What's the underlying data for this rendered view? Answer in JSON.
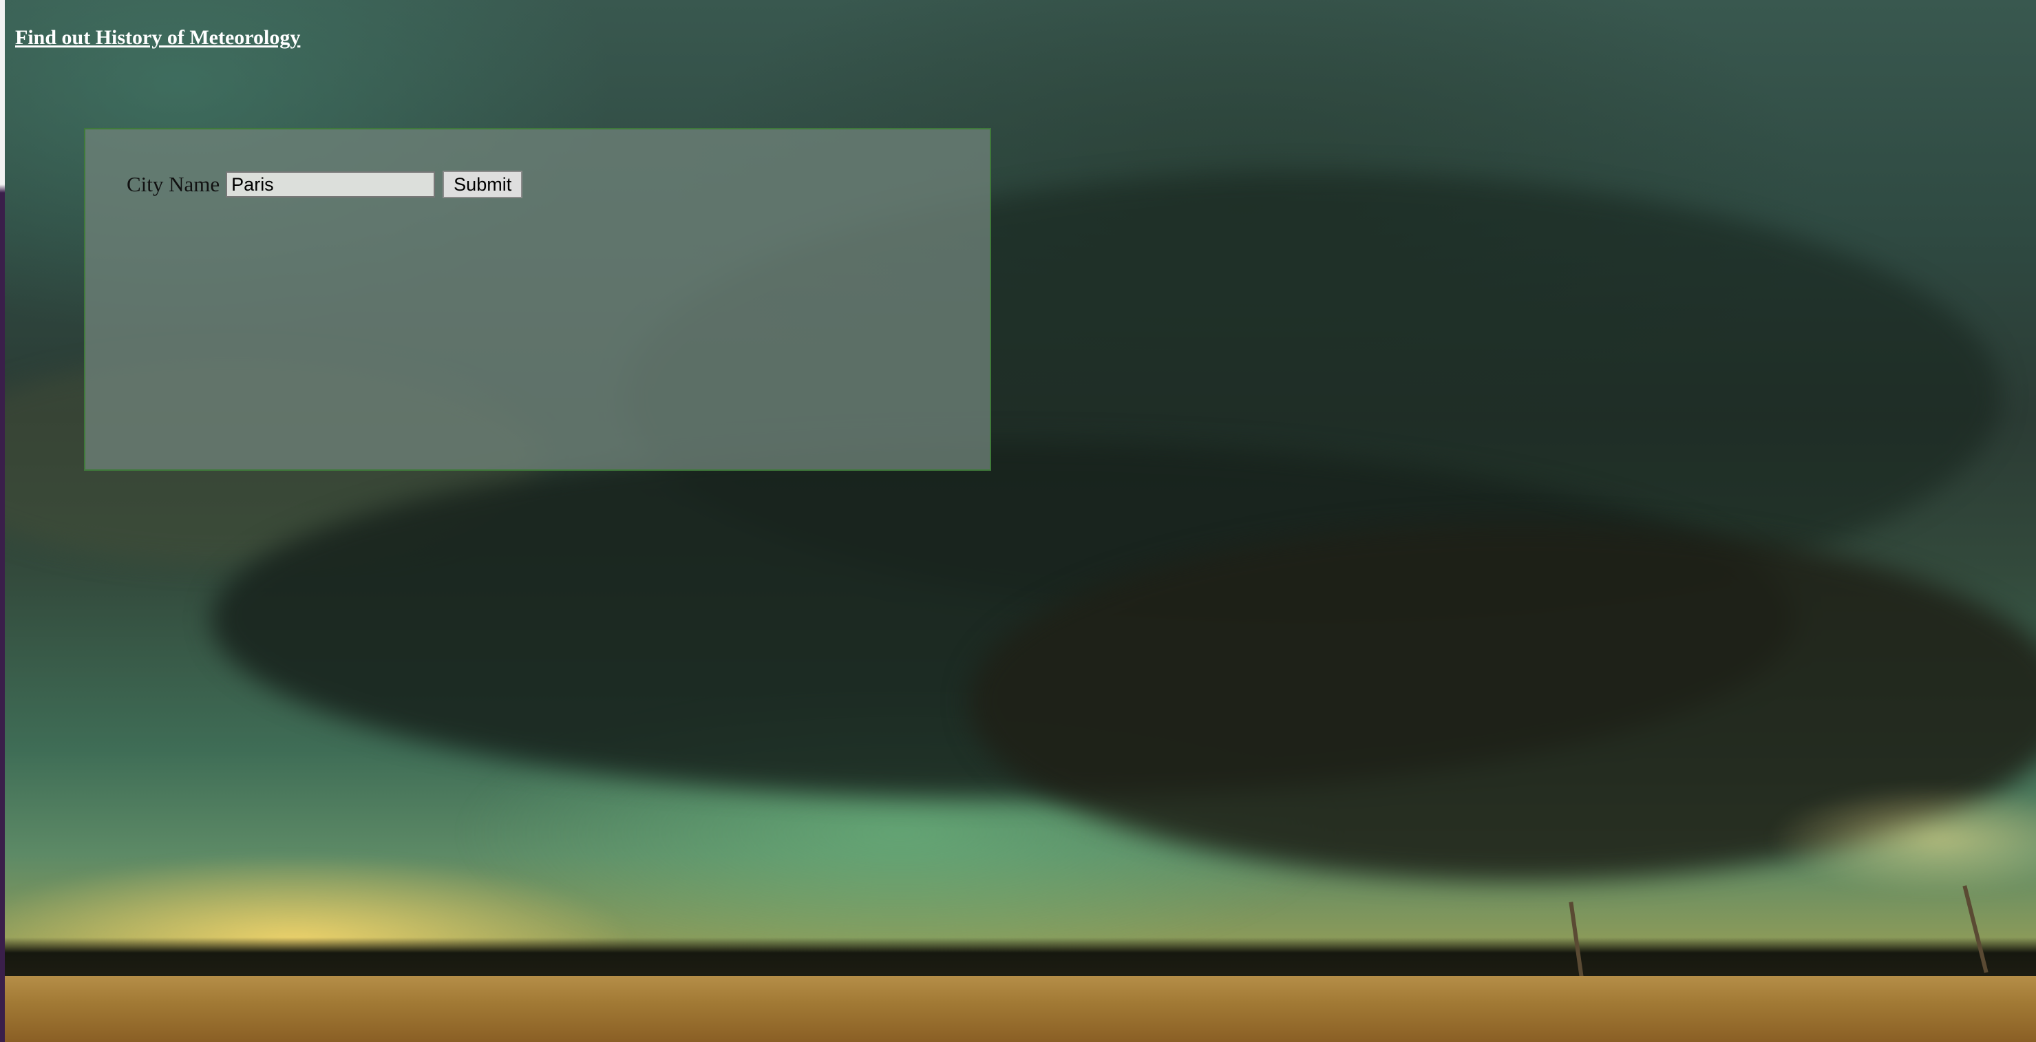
{
  "nav": {
    "history_link": "Find out History of Meteorology"
  },
  "form": {
    "city_label": "City Name",
    "city_value": "Paris",
    "submit_label": "Submit"
  },
  "background": {
    "image_description": "storm-clouds-over-field"
  }
}
